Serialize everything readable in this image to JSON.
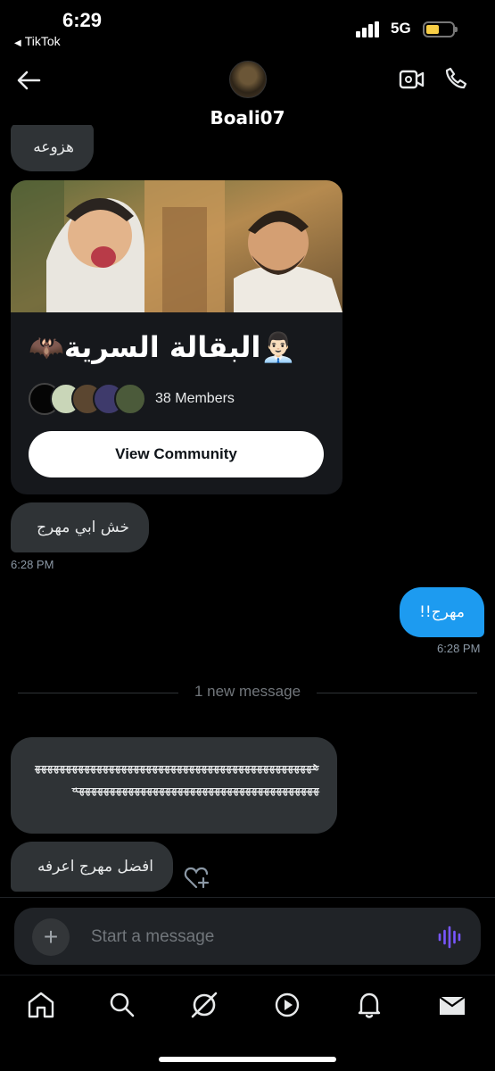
{
  "status_bar": {
    "time": "6:29",
    "back_app": "TikTok",
    "network": "5G"
  },
  "header": {
    "contact_name": "Boali07"
  },
  "messages": {
    "top_partial": "هزوعه",
    "msg1": "خش ابي مهرج",
    "msg1_time": "6:28 PM",
    "msg2": "مهرج!!",
    "msg2_time": "6:28 PM",
    "long_msg": "هههههههههههههههههههههههههههههههههههههههههههههههههههههههههههههههههههههههههههههههههههههه",
    "msg4": "افضل مهرج اعرفه"
  },
  "community_card": {
    "title": "👨🏻‍💼البقالة السرية🦇",
    "members": "38 Members",
    "button": "View Community",
    "member_avatar_colors": [
      "#050505",
      "#c9d6b8",
      "#5b4630",
      "#3e3a6b",
      "#4b5a3a"
    ]
  },
  "divider": {
    "text": "1 new message"
  },
  "composer": {
    "placeholder": "Start a message",
    "plus": "+"
  },
  "colors": {
    "accent": "#1d9bf0",
    "bubble": "#2f3336",
    "voice": "#7856ff"
  }
}
